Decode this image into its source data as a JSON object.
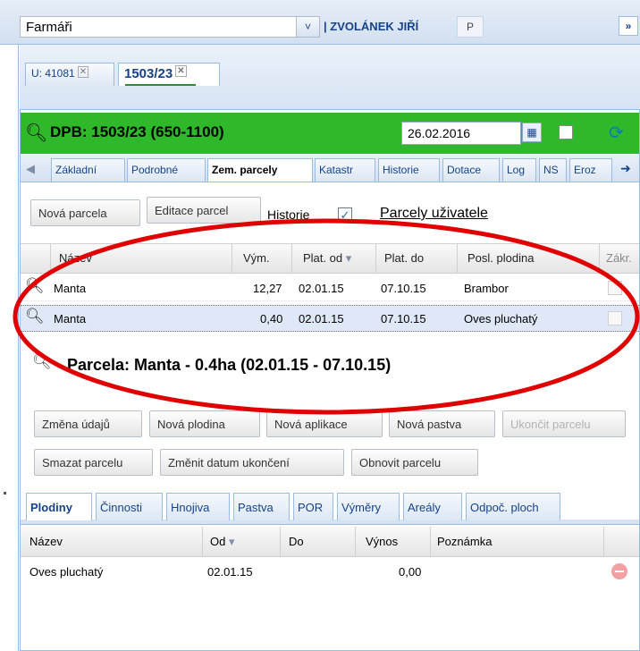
{
  "topbar": {
    "farmer_value": "Farmáři",
    "farmer_arrow": "˅",
    "user_name": "| ZVOLÁNEK JIŘÍ",
    "p_button": "P",
    "expand": "»"
  },
  "doc_tabs": [
    {
      "label": "U: 41081",
      "close": "✕"
    },
    {
      "label": "1503/23",
      "close": "✕"
    }
  ],
  "header": {
    "title": "DPB: 1503/23 (650-1100)",
    "date": "26.02.2016"
  },
  "sub_tabs": [
    "Základní",
    "Podrobné",
    "Zem. parcely",
    "Katastr",
    "Historie",
    "Dotace",
    "Log",
    "NS",
    "Eroz"
  ],
  "toolbar": {
    "new_parcel": "Nová parcela",
    "edit_parcels": "Editace parcel",
    "history_label": "Historie",
    "history_checked": "✓",
    "user_parcels": "Parcely uživatele"
  },
  "parcel_grid": {
    "columns": [
      "Název",
      "Vým.",
      "Plat. od",
      "Plat. do",
      "Posl. plodina",
      "Zákr."
    ],
    "sort_arrow": "▾",
    "rows": [
      {
        "name": "Manta",
        "area": "12,27",
        "from": "02.01.15",
        "to": "07.10.15",
        "crop": "Brambor"
      },
      {
        "name": "Manta",
        "area": "0,40",
        "from": "02.01.15",
        "to": "07.10.15",
        "crop": "Oves pluchatý"
      }
    ]
  },
  "detail": {
    "title": "Parcela: Manta - 0.4ha (02.01.15 - 07.10.15)",
    "buttons_row1": [
      "Změna údajů",
      "Nová plodina",
      "Nová aplikace",
      "Nová pastva",
      "Ukončit parcelu"
    ],
    "buttons_row2": [
      "Smazat parcelu",
      "Změnit datum ukončení",
      "Obnovit parcelu"
    ]
  },
  "detail_tabs": [
    "Plodiny",
    "Činnosti",
    "Hnojiva",
    "Pastva",
    "POR",
    "Výměry",
    "Areály",
    "Odpoč. ploch"
  ],
  "crop_grid": {
    "columns": [
      "Název",
      "Od",
      "Do",
      "Výnos",
      "Poznámka"
    ],
    "sort_arrow": "▾",
    "rows": [
      {
        "name": "Oves pluchatý",
        "from": "02.01.15",
        "to": "",
        "yield": "0,00",
        "note": ""
      }
    ]
  },
  "icons": {
    "search": "search-icon",
    "calendar": "calendar-icon",
    "refresh": "refresh-icon",
    "remove": "remove-icon"
  },
  "colors": {
    "header_green": "#2fb82a",
    "annotation_red": "#e00000",
    "selection": "#dfe8f6"
  }
}
